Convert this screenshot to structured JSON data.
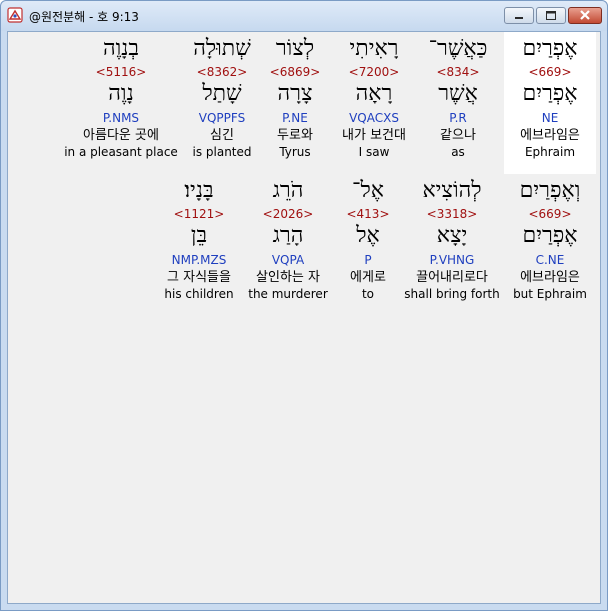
{
  "window": {
    "title": "@원전분해 - 호 9:13"
  },
  "rows": [
    {
      "words": [
        {
          "hebrew": "אֶפְרַיִם",
          "strong": "<669>",
          "lemma": "אֶפְרַיִם",
          "parse": "NE",
          "korean": "에브라임은",
          "english": "Ephraim",
          "highlight": true
        },
        {
          "hebrew": "כַּאֲשֶׁר־",
          "strong": "<834>",
          "lemma": "אֲשֶׁר",
          "parse": "P.R",
          "korean": "같으나",
          "english": "as",
          "highlight": false
        },
        {
          "hebrew": "רָאִיתִי",
          "strong": "<7200>",
          "lemma": "רָאָה",
          "parse": "VQACXS",
          "korean": "내가 보건대",
          "english": "I saw",
          "highlight": false
        },
        {
          "hebrew": "לְצוֹר",
          "strong": "<6869>",
          "lemma": "צָרָה",
          "parse": "P.NE",
          "korean": "두로와",
          "english": "Tyrus",
          "highlight": false
        },
        {
          "hebrew": "שְׁתוּלָה",
          "strong": "<8362>",
          "lemma": "שָׁתַל",
          "parse": "VQPPFS",
          "korean": "심긴",
          "english": "is planted",
          "highlight": false
        },
        {
          "hebrew": "בְנָוֶה",
          "strong": "<5116>",
          "lemma": "נָוֶה",
          "parse": "P.NMS",
          "korean": "아름다운 곳에",
          "english": "in a pleasant place",
          "highlight": false
        }
      ]
    },
    {
      "words": [
        {
          "hebrew": "וְאֶפְרַיִם",
          "strong": "<669>",
          "lemma": "אֶפְרַיִם",
          "parse": "C.NE",
          "korean": "에브라임은",
          "english": "but Ephraim",
          "highlight": false
        },
        {
          "hebrew": "לְהוֹצִיא",
          "strong": "<3318>",
          "lemma": "יָצָא",
          "parse": "P.VHNG",
          "korean": "끌어내리로다",
          "english": "shall bring forth",
          "highlight": false
        },
        {
          "hebrew": "אֶל־",
          "strong": "<413>",
          "lemma": "אֶל",
          "parse": "P",
          "korean": "에게로",
          "english": "to",
          "highlight": false
        },
        {
          "hebrew": "הֹרֵג",
          "strong": "<2026>",
          "lemma": "הָרַג",
          "parse": "VQPA",
          "korean": "살인하는 자",
          "english": "the murderer",
          "highlight": false
        },
        {
          "hebrew": "בָּנָיו׃",
          "strong": "<1121>",
          "lemma": "בֵּן",
          "parse": "NMP.MZS",
          "korean": "그 자식들을",
          "english": "his children",
          "highlight": false
        }
      ]
    }
  ],
  "colors": {
    "strong": "#a01010",
    "parse": "#1f3fbf",
    "highlight_bg": "#ffffff",
    "client_bg": "#f0f0f0"
  },
  "icons": [
    "app-icon",
    "minimize-icon",
    "maximize-icon",
    "close-icon"
  ]
}
